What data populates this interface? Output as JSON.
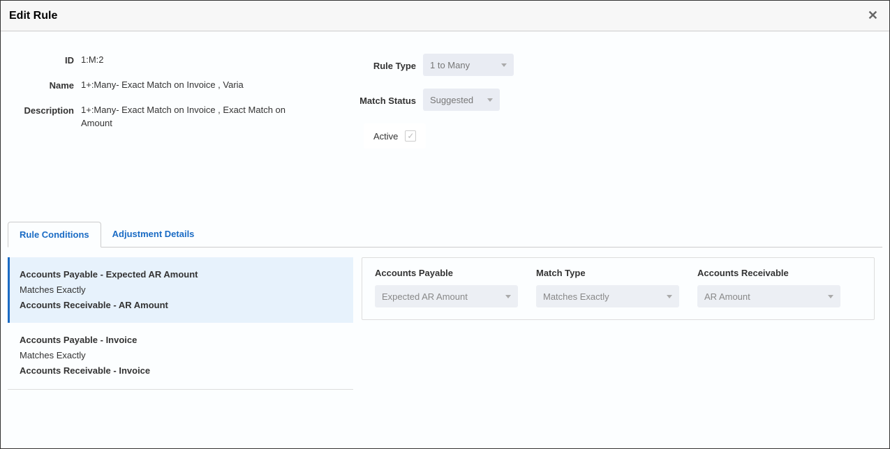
{
  "dialog": {
    "title": "Edit Rule"
  },
  "form": {
    "id_label": "ID",
    "id_value": "1:M:2",
    "name_label": "Name",
    "name_value": "1+:Many- Exact Match on Invoice , Varia",
    "desc_label": "Description",
    "desc_value": "1+:Many- Exact Match on Invoice , Exact Match on Amount",
    "ruletype_label": "Rule Type",
    "ruletype_value": "1 to Many",
    "matchstatus_label": "Match Status",
    "matchstatus_value": "Suggested",
    "active_label": "Active"
  },
  "tabs": {
    "t1": "Rule Conditions",
    "t2": "Adjustment Details"
  },
  "conditions": {
    "c1": {
      "line1_a": "Accounts Payable",
      "line1_sep": "   -   ",
      "line1_b": "Expected AR Amount",
      "match": "Matches Exactly",
      "line2_a": "Accounts Receivable",
      "line2_sep": "   -   ",
      "line2_b": "AR Amount"
    },
    "c2": {
      "line1_a": "Accounts Payable",
      "line1_sep": "   -   ",
      "line1_b": "Invoice",
      "match": "Matches Exactly",
      "line2_a": "Accounts Receivable",
      "line2_sep": "   -   ",
      "line2_b": "Invoice"
    }
  },
  "detail": {
    "ap_label": "Accounts Payable",
    "ap_value": "Expected AR Amount",
    "mt_label": "Match Type",
    "mt_value": "Matches Exactly",
    "ar_label": "Accounts Receivable",
    "ar_value": "AR Amount"
  }
}
